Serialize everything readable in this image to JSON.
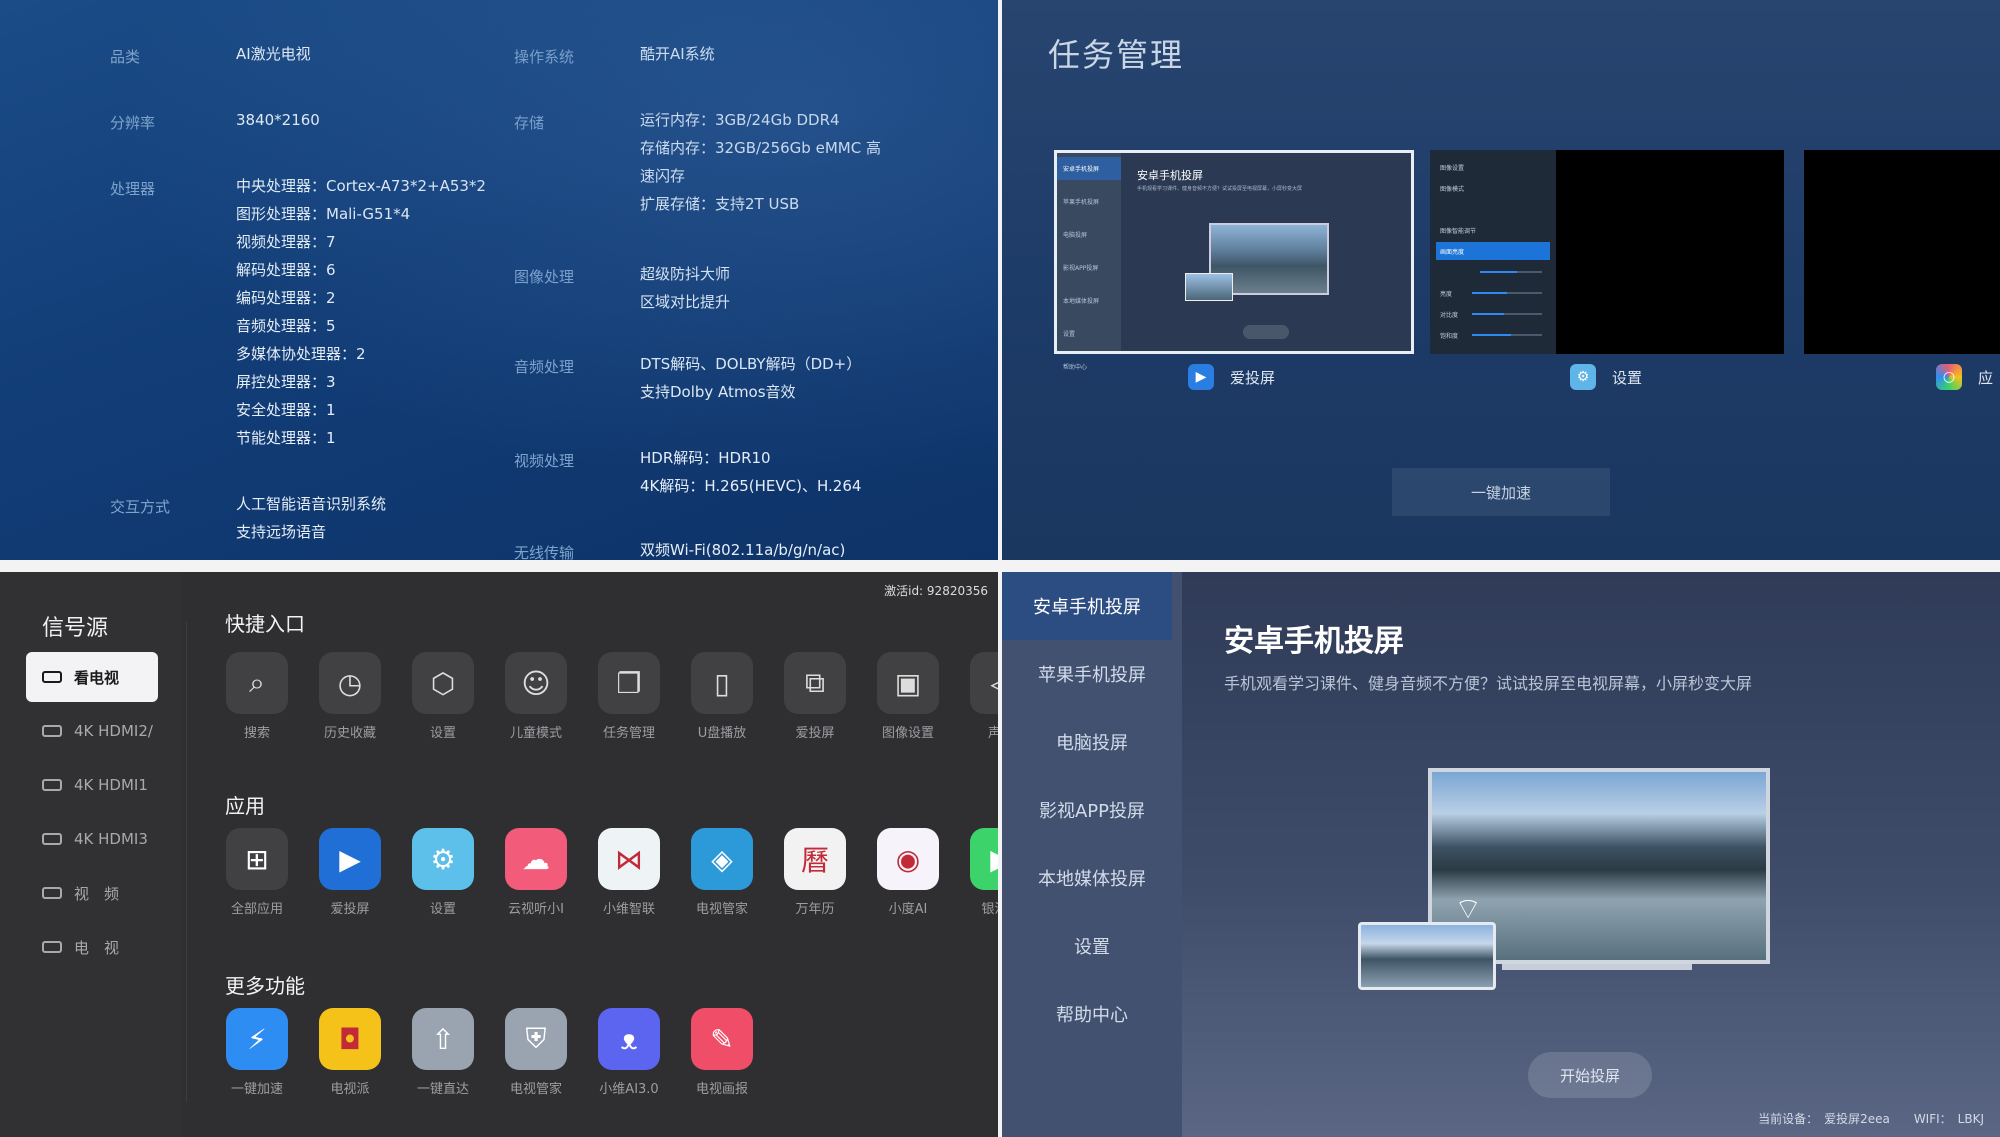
{
  "specs": {
    "left": [
      {
        "label": "品类",
        "values": [
          "AI激光电视"
        ]
      },
      {
        "label": "分辨率",
        "values": [
          "3840*2160"
        ]
      },
      {
        "label": "处理器",
        "values": [
          "中央处理器：Cortex-A73*2+A53*2",
          "图形处理器：Mali-G51*4",
          "视频处理器：7",
          "解码处理器：6",
          "编码处理器：2",
          "音频处理器：5",
          "多媒体协处理器：2",
          "屏控处理器：3",
          "安全处理器：1",
          "节能处理器：1"
        ]
      },
      {
        "label": "交互方式",
        "values": [
          "人工智能语音识别系统",
          "支持远场语音"
        ]
      }
    ],
    "right": [
      {
        "label": "操作系统",
        "values": [
          "酷开AI系统"
        ]
      },
      {
        "label": "存储",
        "values": [
          "运行内存：3GB/24Gb DDR4",
          "存储内存：32GB/256Gb eMMC 高",
          "速闪存",
          "扩展存储：支持2T USB"
        ]
      },
      {
        "label": "图像处理",
        "values": [
          "超级防抖大师",
          "区域对比提升"
        ]
      },
      {
        "label": "音频处理",
        "values": [
          "DTS解码、DOLBY解码（DD+）",
          "支持Dolby Atmos音效"
        ]
      },
      {
        "label": "视频处理",
        "values": [
          "HDR解码：HDR10",
          "4K解码：H.265(HEVC)、H.264"
        ]
      },
      {
        "label": "无线传输",
        "values": [
          "双频Wi-Fi(802.11a/b/g/n/ac)"
        ]
      }
    ]
  },
  "task_manager": {
    "title": "任务管理",
    "tasks": [
      {
        "label": "爱投屏",
        "icon": "screencast-icon",
        "color": "#2a7de1"
      },
      {
        "label": "设置",
        "icon": "gear-icon",
        "color": "#5fb4e8"
      },
      {
        "label": "应",
        "icon": "app-icon",
        "color": "#e85d75"
      }
    ],
    "mini_cast": {
      "title": "安卓手机投屏",
      "sub": "手机观看学习课件、健身音频不方便？试试投屏至电视屏幕，小屏秒变大屏",
      "nav": [
        "安卓手机投屏",
        "苹果手机投屏",
        "电脑投屏",
        "影视APP投屏",
        "本地媒体投屏",
        "设置",
        "帮助中心"
      ]
    },
    "mini_settings": {
      "title": "图像设置",
      "rows": [
        "图像模式",
        "",
        "图像智能调节",
        "画面亮度",
        "",
        "亮度",
        "对比度",
        "饱和度"
      ]
    },
    "speed_button": "一键加速"
  },
  "launcher": {
    "activation": "激活id: 92820356",
    "source_title": "信号源",
    "sources": [
      {
        "label": "看电视",
        "active": true
      },
      {
        "label": "4K HDMI2/",
        "active": false
      },
      {
        "label": "4K HDMI1",
        "active": false
      },
      {
        "label": "4K HDMI3",
        "active": false
      },
      {
        "label": "视　频",
        "active": false
      },
      {
        "label": "电　视",
        "active": false
      }
    ],
    "quick_title": "快捷入口",
    "quick": [
      {
        "label": "搜索",
        "glyph": "⌕",
        "icon": "search-icon"
      },
      {
        "label": "历史收藏",
        "glyph": "◷",
        "icon": "clock-icon"
      },
      {
        "label": "设置",
        "glyph": "⬡",
        "icon": "hexagon-settings-icon"
      },
      {
        "label": "儿童模式",
        "glyph": "☺",
        "icon": "child-icon"
      },
      {
        "label": "任务管理",
        "glyph": "❐",
        "icon": "task-icon"
      },
      {
        "label": "U盘播放",
        "glyph": "▯",
        "icon": "usb-icon"
      },
      {
        "label": "爱投屏",
        "glyph": "⧉",
        "icon": "cast-icon"
      },
      {
        "label": "图像设置",
        "glyph": "▣",
        "icon": "image-icon"
      },
      {
        "label": "声音",
        "glyph": "◁",
        "icon": "sound-icon"
      }
    ],
    "apps_title": "应用",
    "apps": [
      {
        "label": "全部应用",
        "glyph": "⊞",
        "icon": "grid-icon",
        "color": "#414144"
      },
      {
        "label": "爱投屏",
        "glyph": "▶",
        "icon": "screencast-app-icon",
        "color": "#1f6fd6"
      },
      {
        "label": "设置",
        "glyph": "⚙",
        "icon": "settings-app-icon",
        "color": "#5cc0ea"
      },
      {
        "label": "云视听小I",
        "glyph": "☁",
        "icon": "cloud-tv-icon",
        "color": "#f25b7a"
      },
      {
        "label": "小维智联",
        "glyph": "⋈",
        "icon": "smart-link-icon",
        "color": "#eef3f6"
      },
      {
        "label": "电视管家",
        "glyph": "◈",
        "icon": "tv-manager-icon",
        "color": "#2c9ad8"
      },
      {
        "label": "万年历",
        "glyph": "曆",
        "icon": "calendar-icon",
        "color": "#f2f2f2"
      },
      {
        "label": "小度AI",
        "glyph": "◉",
        "icon": "xiaodu-icon",
        "color": "#f6f3fb"
      },
      {
        "label": "银河奇",
        "glyph": "▶",
        "icon": "galaxy-icon",
        "color": "#3bd36a"
      }
    ],
    "more_title": "更多功能",
    "more": [
      {
        "label": "一键加速",
        "glyph": "⚡",
        "icon": "lightning-icon",
        "color": "#2e8df2"
      },
      {
        "label": "电视派",
        "glyph": "◘",
        "icon": "tvpai-icon",
        "color": "#f5c21a"
      },
      {
        "label": "一键直达",
        "glyph": "⇧",
        "icon": "upload-icon",
        "color": "#9aa4b0"
      },
      {
        "label": "电视管家",
        "glyph": "⛨",
        "icon": "shield-icon",
        "color": "#9aa4b0"
      },
      {
        "label": "小维AI3.0",
        "glyph": "ᴥ",
        "icon": "cat-icon",
        "color": "#5b65f0"
      },
      {
        "label": "电视画报",
        "glyph": "✎",
        "icon": "pencil-icon",
        "color": "#f04e68"
      }
    ]
  },
  "cast": {
    "nav": [
      {
        "label": "安卓手机投屏",
        "active": true
      },
      {
        "label": "苹果手机投屏",
        "active": false
      },
      {
        "label": "电脑投屏",
        "active": false
      },
      {
        "label": "影视APP投屏",
        "active": false
      },
      {
        "label": "本地媒体投屏",
        "active": false
      },
      {
        "label": "设置",
        "active": false
      },
      {
        "label": "帮助中心",
        "active": false
      }
    ],
    "title": "安卓手机投屏",
    "desc": "手机观看学习课件、健身音频不方便？试试投屏至电视屏幕，小屏秒变大屏",
    "start_button": "开始投屏",
    "status": "当前设备：　爱投屏2eea　　WIFI：　LBKJ"
  }
}
